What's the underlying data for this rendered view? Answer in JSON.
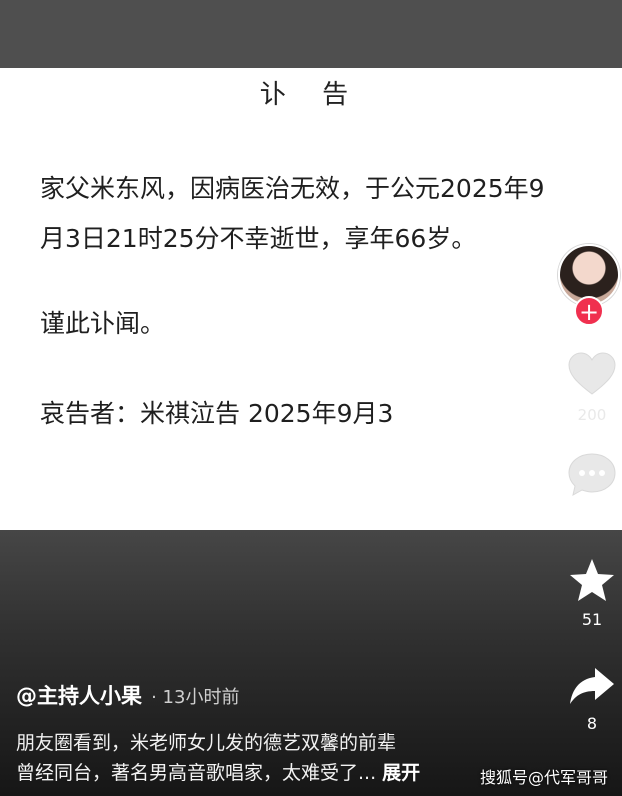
{
  "notice": {
    "title": "讣 告",
    "body_line1": "家父米东风，因病医治无效，于公元2025年9",
    "body_line2": "月3日21时25分不幸逝世，享年66岁。",
    "closing": "谨此讣闻。",
    "signature": "哀告者：米祺泣告 2025年9月3"
  },
  "rail": {
    "like_count": "200",
    "favorite_count": "51",
    "share_count": "8",
    "follow_label": "+",
    "icons": [
      "avatar",
      "plus-icon",
      "heart-icon",
      "comment-icon",
      "star-icon",
      "share-arrow-icon"
    ]
  },
  "post": {
    "author": "@主持人小果",
    "time": "· 13小时前",
    "caption_line1": "朋友圈看到，米老师女儿发的德艺双馨的前辈",
    "caption_line2": "曾经同台，著名男高音歌唱家，太难受了...",
    "expand_label": "展开"
  },
  "watermark": "搜狐号@代军哥哥",
  "colors": {
    "follow_accent": "#f0304f",
    "notice_bg": "#ffffff",
    "overlay_dark": "#1f1f1f"
  }
}
